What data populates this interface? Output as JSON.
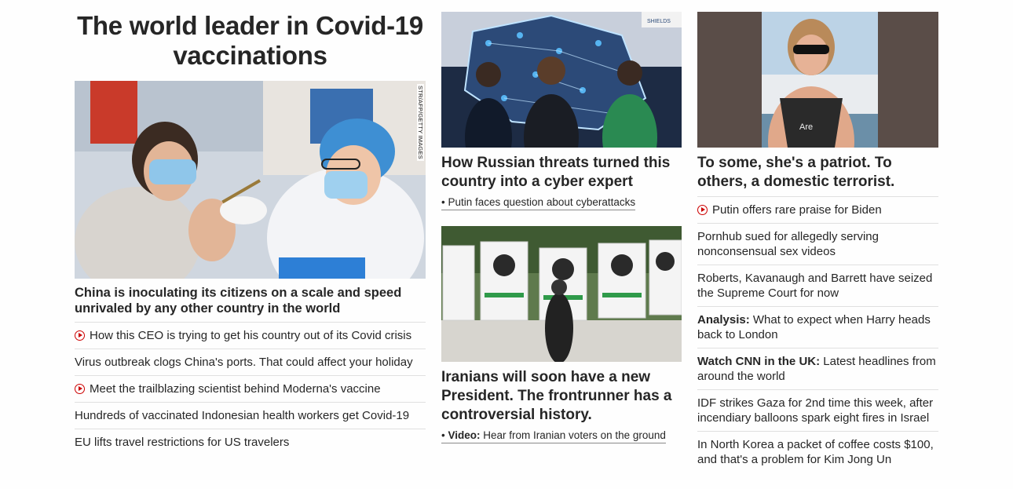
{
  "main": {
    "title": "The world leader in Covid-19 vaccinations",
    "image_credit": "STR/AFP/GETTY IMAGES",
    "headline": "China is inoculating its citizens on a scale and speed unrivaled by any other country in the world",
    "links": [
      {
        "text": "How this CEO is trying to get his country out of its Covid crisis",
        "video": true
      },
      {
        "text": "Virus outbreak clogs China's ports. That could affect your holiday",
        "video": false
      },
      {
        "text": "Meet the trailblazing scientist behind Moderna's vaccine",
        "video": true
      },
      {
        "text": "Hundreds of vaccinated Indonesian health workers get Covid-19",
        "video": false
      },
      {
        "text": "EU lifts travel restrictions for US travelers",
        "video": false
      }
    ]
  },
  "middle": {
    "card1": {
      "headline": "How Russian threats turned this country into a cyber expert",
      "sublink": "Putin faces question about cyberattacks",
      "image_sign": "SHIELDS"
    },
    "card2": {
      "headline": "Iranians will soon have a new President. The frontrunner has a controversial history.",
      "sublink_prefix": "Video:",
      "sublink": "Hear from Iranian voters on the ground"
    }
  },
  "right": {
    "card": {
      "headline": "To some, she's a patriot. To others, a domestic terrorist.",
      "shirt_text": "Are"
    },
    "links": [
      {
        "text": "Putin offers rare praise for Biden",
        "video": true
      },
      {
        "text": "Pornhub sued for allegedly serving nonconsensual sex videos"
      },
      {
        "text": "Roberts, Kavanaugh and Barrett have seized the Supreme Court for now"
      },
      {
        "prefix": "Analysis:",
        "text": "What to expect when Harry heads back to London"
      },
      {
        "prefix": "Watch CNN in the UK:",
        "text": "Latest headlines from around the world"
      },
      {
        "text": "IDF strikes Gaza for 2nd time this week, after incendiary balloons spark eight fires in Israel"
      },
      {
        "text": "In North Korea a packet of coffee costs $100, and that's a problem for Kim Jong Un"
      }
    ]
  },
  "colors": {
    "text": "#262626",
    "divider": "#e0e0e0",
    "video_red": "#cc0000"
  },
  "icons": {
    "video": "play-circle-icon"
  }
}
